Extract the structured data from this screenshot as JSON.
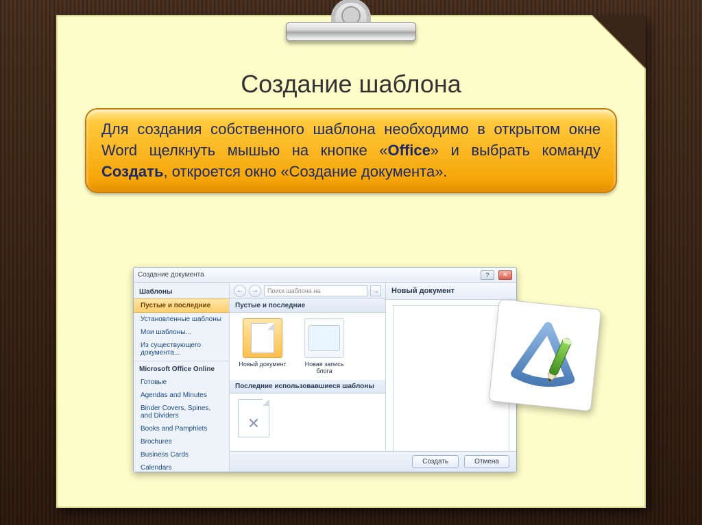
{
  "slide": {
    "title": "Создание шаблона",
    "callout_pre": "Для создания собственного шаблона необходимо в открытом окне  Word  щелкнуть мышью на кнопке «",
    "callout_b1": "Office",
    "callout_mid": "» и выбрать команду ",
    "callout_b2": "Создать",
    "callout_post": ", откроется окно «Создание документа»."
  },
  "dialog": {
    "title": "Создание документа",
    "help_symbol": "?",
    "close_symbol": "✕",
    "sidebar": {
      "header1": "Шаблоны",
      "sel": "Пустые и последние",
      "items_top": [
        "Установленные шаблоны",
        "Мои шаблоны...",
        "Из существующего документа..."
      ],
      "header2": "Microsoft Office Online",
      "items_online": [
        "Готовые",
        "Agendas and Minutes",
        "Binder Covers, Spines, and Dividers",
        "Books and Pamphlets",
        "Brochures",
        "Business Cards",
        "Calendars"
      ]
    },
    "toolbar": {
      "back": "←",
      "fwd": "→",
      "search_placeholder": "Поиск шаблона на",
      "go": "→"
    },
    "sections": {
      "h1": "Пустые и последние",
      "thumb1": "Новый документ",
      "thumb2": "Новая запись блога",
      "h2": "Последние использовавшиеся шаблоны"
    },
    "preview": {
      "header": "Новый документ"
    },
    "footer": {
      "create": "Создать",
      "cancel": "Отмена"
    }
  }
}
